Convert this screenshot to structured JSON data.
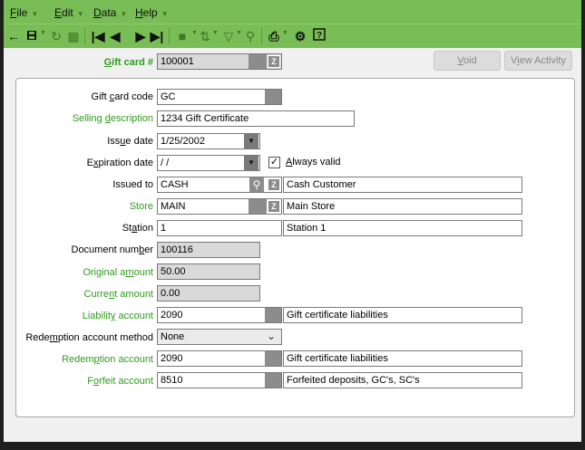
{
  "menu": {
    "file": {
      "u": "F",
      "rest": "ile"
    },
    "edit": {
      "u": "E",
      "rest": "dit"
    },
    "data": {
      "u": "D",
      "rest": "ata"
    },
    "help": {
      "u": "H",
      "rest": "elp"
    }
  },
  "header": {
    "gift_card_label_pre": "",
    "gift_card_label_u": "G",
    "gift_card_label_post": "ift card #",
    "gift_card_value": "100001",
    "void_pre": "",
    "void_u": "V",
    "void_post": "oid",
    "view_pre": "V",
    "view_u": "i",
    "view_post": "ew Activity"
  },
  "form": {
    "code": {
      "label_pre": "Gift ",
      "label_u": "c",
      "label_post": "ard code",
      "value": "GC"
    },
    "selling": {
      "label_pre": "Selling ",
      "label_u": "d",
      "label_post": "escription",
      "value": "1234 Gift Certificate"
    },
    "issue_date": {
      "label_pre": "Iss",
      "label_u": "u",
      "label_post": "e date",
      "value": "1/25/2002"
    },
    "expiration": {
      "label_pre": "E",
      "label_u": "x",
      "label_post": "piration date",
      "value": " / /",
      "always_pre": "",
      "always_u": "A",
      "always_post": "lways valid",
      "always_checked": true
    },
    "issued_to": {
      "label_pre": "Issued to",
      "label_u": "",
      "label_post": "",
      "value": "CASH",
      "desc": "Cash Customer"
    },
    "store": {
      "label_pre": "Store",
      "label_u": "",
      "label_post": "",
      "value": "MAIN",
      "desc": "Main Store"
    },
    "station": {
      "label_pre": "St",
      "label_u": "a",
      "label_post": "tion",
      "value": "1",
      "desc": "Station 1"
    },
    "doc_number": {
      "label_pre": "Document num",
      "label_u": "b",
      "label_post": "er",
      "value": "100116"
    },
    "original_amount": {
      "label_pre": "Original a",
      "label_u": "m",
      "label_post": "ount",
      "value": "50.00"
    },
    "current_amount": {
      "label_pre": "Curre",
      "label_u": "n",
      "label_post": "t amount",
      "value": "0.00"
    },
    "liability": {
      "label_pre": "Liabilit",
      "label_u": "y",
      "label_post": " account",
      "value": "2090",
      "desc": "Gift certificate liabilities"
    },
    "redemption_method": {
      "label_pre": "Rede",
      "label_u": "m",
      "label_post": "ption account method",
      "value": "None"
    },
    "redemption_account": {
      "label_pre": "Redem",
      "label_u": "p",
      "label_post": "tion account",
      "value": "2090",
      "desc": "Gift certificate liabilities"
    },
    "forfeit": {
      "label_pre": "F",
      "label_u": "o",
      "label_post": "rfeit account",
      "value": "8510",
      "desc": "Forfeited deposits, GC's, SC's"
    }
  },
  "colors": {
    "accent": "#78bd55",
    "label_green": "#2f9a1c"
  },
  "icons": [
    "back-arrow-icon",
    "save-icon",
    "refresh-icon",
    "grid-icon",
    "first-record-icon",
    "previous-record-icon",
    "next-record-icon",
    "last-record-icon",
    "batch-icon",
    "sort-icon",
    "filter-icon",
    "search-icon",
    "print-icon",
    "settings-icon",
    "help-icon"
  ]
}
